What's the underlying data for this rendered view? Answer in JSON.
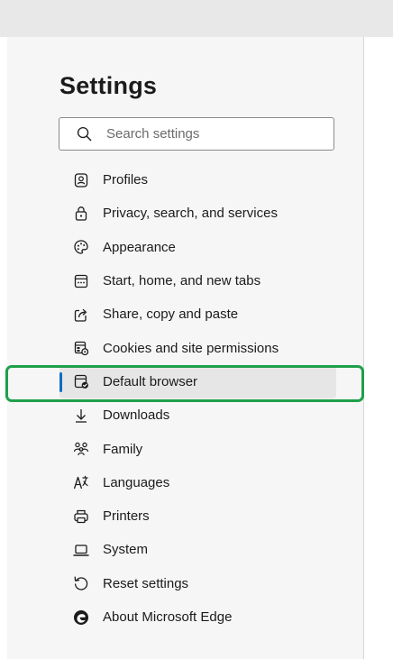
{
  "settings": {
    "title": "Settings"
  },
  "search": {
    "placeholder": "Search settings",
    "value": ""
  },
  "nav": {
    "items": [
      {
        "label": "Profiles",
        "icon": "profile-icon"
      },
      {
        "label": "Privacy, search, and services",
        "icon": "lock-icon"
      },
      {
        "label": "Appearance",
        "icon": "palette-icon"
      },
      {
        "label": "Start, home, and new tabs",
        "icon": "start-tabs-icon"
      },
      {
        "label": "Share, copy and paste",
        "icon": "share-icon"
      },
      {
        "label": "Cookies and site permissions",
        "icon": "cookies-permissions-icon"
      },
      {
        "label": "Default browser",
        "icon": "default-browser-icon",
        "selected": true
      },
      {
        "label": "Downloads",
        "icon": "download-icon"
      },
      {
        "label": "Family",
        "icon": "family-icon"
      },
      {
        "label": "Languages",
        "icon": "languages-icon"
      },
      {
        "label": "Printers",
        "icon": "printer-icon"
      },
      {
        "label": "System",
        "icon": "laptop-icon"
      },
      {
        "label": "Reset settings",
        "icon": "reset-icon"
      },
      {
        "label": "About Microsoft Edge",
        "icon": "edge-logo-icon"
      }
    ]
  },
  "colors": {
    "accent": "#0f6cbd",
    "highlight_outline": "#1ea04a",
    "selected_background": "#e6e6e6",
    "sidebar_background": "#f6f6f6"
  }
}
